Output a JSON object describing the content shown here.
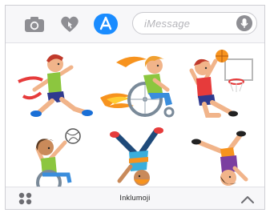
{
  "toolbar": {
    "icons": [
      "camera-icon",
      "heart-touch-icon",
      "app-store-icon"
    ],
    "message_placeholder": "iMessage",
    "mic_icon": "microphone-icon"
  },
  "sticker_pack": {
    "app_name": "Inklumoji",
    "stickers": [
      "runner-crossing-finish-line",
      "wheelchair-racer",
      "basketball-player",
      "wheelchair-volleyball-player",
      "breakdancer",
      "cartwheel-kid"
    ]
  },
  "bottom_bar": {
    "app_name": "Inklumoji",
    "left_icon": "app-grid-icon",
    "right_icon": "chevron-up-icon"
  },
  "colors": {
    "accent": "#1a8cff",
    "toolbar_bg": "#f7f7f9",
    "icon_gray": "#8e8e93"
  }
}
